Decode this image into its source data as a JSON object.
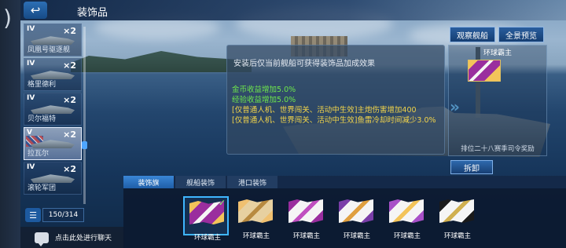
{
  "header": {
    "title": "装饰品"
  },
  "top_buttons": {
    "observe": "观察舰船",
    "panorama": "全景预览"
  },
  "info_panel": {
    "title": "安装后仅当前舰船可获得装饰品加成效果",
    "bonuses": [
      {
        "text": "金币收益增加5.0%",
        "color": "#6ee84c"
      },
      {
        "text": "经验收益增加5.0%",
        "color": "#6ee84c"
      },
      {
        "text": "[仅普通人机、世界闯关、活动中生效]主炮伤害增加400",
        "color": "#f2d44a"
      },
      {
        "text": "[仅普通人机、世界闯关、活动中生效]鱼雷冷却时间减少3.0%",
        "color": "#f2d44a"
      }
    ]
  },
  "card": {
    "title": "环球霸主",
    "subtitle": "排位二十八赛季司令奖励",
    "dismantle": "拆卸"
  },
  "tabs": {
    "flags": "装饰旗",
    "ship_deco": "舰船装饰",
    "port_deco": "港口装饰"
  },
  "ship_list": [
    {
      "tier": "IV",
      "mult": "×2",
      "name": "凤凰号驱逐舰"
    },
    {
      "tier": "IV",
      "mult": "×2",
      "name": "格里德利"
    },
    {
      "tier": "IV",
      "mult": "×2",
      "name": "贝尔福特"
    },
    {
      "tier": "V",
      "mult": "×2",
      "name": "拉瓦尔"
    },
    {
      "tier": "IV",
      "mult": "×2",
      "name": "滚轮军团"
    }
  ],
  "counter": "150/314",
  "chat": {
    "hint": "点击此处进行聊天"
  },
  "decorations": [
    {
      "name": "环球霸主",
      "colors": [
        "#f3c45a",
        "#9a2e9e",
        "#f5f5f5"
      ],
      "selected": true
    },
    {
      "name": "环球霸主",
      "colors": [
        "#f0c070",
        "#e7d0a0",
        "#b88a40"
      ],
      "selected": false
    },
    {
      "name": "环球霸主",
      "colors": [
        "#9a2e9e",
        "#f5f5f5",
        "#c050c0"
      ],
      "selected": false
    },
    {
      "name": "环球霸主",
      "colors": [
        "#7a3ea8",
        "#f5f5f5",
        "#e0a040"
      ],
      "selected": false
    },
    {
      "name": "环球霸主",
      "colors": [
        "#a850c8",
        "#f5f5f5",
        "#f3c45a"
      ],
      "selected": false
    },
    {
      "name": "环球霸主",
      "colors": [
        "#1a1a1a",
        "#f5f5f5",
        "#d0b050"
      ],
      "selected": false
    }
  ]
}
